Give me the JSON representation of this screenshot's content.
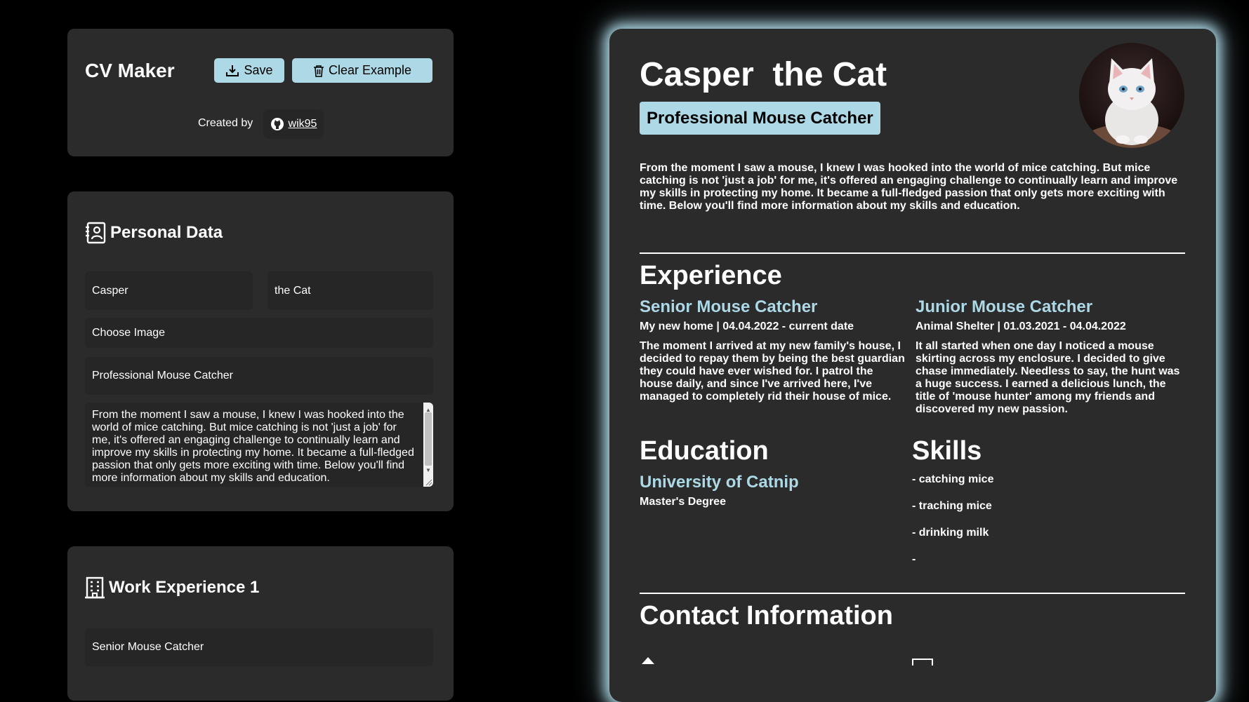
{
  "app": {
    "title": "CV Maker",
    "save_label": "Save",
    "clear_label": "Clear Example",
    "created_by_label": "Created by",
    "github_user": "wik95"
  },
  "personal": {
    "section_title": "Personal Data",
    "first_name": "Casper",
    "last_name": "the Cat",
    "image_label": "Choose Image",
    "title": "Professional Mouse Catcher",
    "about": "From the moment I saw a mouse, I knew I was hooked into the world of mice catching. But mice catching is not 'just a job' for me, it's offered an engaging challenge to continually learn and improve my skills in protecting my home. It became a full-fledged passion that only gets more exciting with time. Below you'll find more information about my skills and education."
  },
  "work": {
    "section_title": "Work Experience 1",
    "position": "Senior Mouse Catcher"
  },
  "cv": {
    "name": "Casper  the Cat",
    "role": "Professional Mouse Catcher",
    "about": "From the moment I saw a mouse, I knew I was hooked into the world of mice catching. But mice catching is not 'just a job' for me, it's offered an engaging challenge to continually learn and improve my skills in protecting my home. It became a full-fledged passion that only gets more exciting with time. Below you'll find more information about my skills and education.",
    "experience_heading": "Experience",
    "jobs": [
      {
        "title": "Senior Mouse Catcher",
        "meta": "My new home | 04.04.2022 - current date",
        "desc": "The moment I arrived at my new family's house, I decided to repay them by being the best guardian they could have ever wished for. I patrol the house daily, and since I've arrived here, I've managed to completely rid their house of mice."
      },
      {
        "title": "Junior Mouse Catcher",
        "meta": "Animal Shelter | 01.03.2021 - 04.04.2022",
        "desc": "It all started when one day I noticed a mouse skirting across my enclosure. I decided to give chase immediately. Needless to say, the hunt was a huge success. I earned a delicious lunch, the title of 'mouse hunter' among my friends and discovered my new passion."
      }
    ],
    "education_heading": "Education",
    "school": "University of Catnip",
    "degree": "Master's Degree",
    "skills_heading": "Skills",
    "skills": [
      "- catching mice",
      "- traching mice",
      "- drinking milk",
      "-"
    ],
    "contact_heading": "Contact Information"
  },
  "colors": {
    "accent": "#add8e6",
    "panel": "#2b2b2b",
    "field": "#262626",
    "background": "#000000"
  },
  "icons": {
    "save": "download-icon",
    "clear": "trash-icon",
    "github": "github-icon",
    "personal": "contact-card-icon",
    "work": "building-icon"
  }
}
